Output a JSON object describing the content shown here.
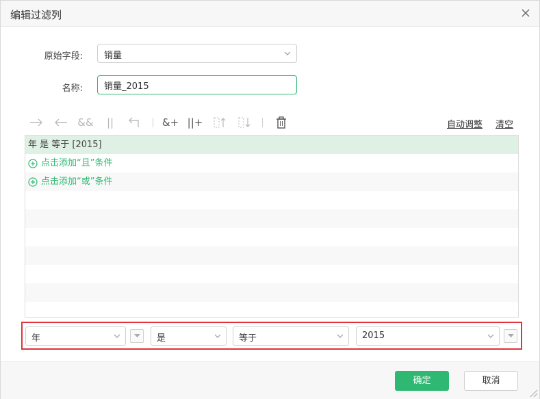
{
  "dialog": {
    "title": "编辑过滤列"
  },
  "form": {
    "source_field_label": "原始字段:",
    "source_field_value": "销量",
    "name_label": "名称:",
    "name_value": "销量_2015"
  },
  "toolbar": {
    "icons": [
      "arrow-right-icon",
      "arrow-left-icon",
      "and-icon",
      "or-icon",
      "undo-turn-icon",
      "add-and-icon",
      "add-or-icon",
      "move-up-icon",
      "move-down-icon",
      "delete-icon"
    ],
    "and_text": "&&",
    "or_text": "||",
    "add_and_text": "&+",
    "add_or_text": "||+",
    "auto_adjust_label": "自动调整",
    "clear_label": "清空"
  },
  "conditions": {
    "rows": [
      {
        "text": "年 是 等于 [2015]"
      }
    ],
    "add_and_label": "点击添加“且”条件",
    "add_or_label": "点击添加“或”条件"
  },
  "editor": {
    "field": "年",
    "operator": "是",
    "comparator": "等于",
    "value": "2015"
  },
  "footer": {
    "ok_label": "确定",
    "cancel_label": "取消"
  },
  "colors": {
    "accent": "#2eb872",
    "selected_row": "#dff0e4",
    "highlight_border": "#e0323a"
  }
}
